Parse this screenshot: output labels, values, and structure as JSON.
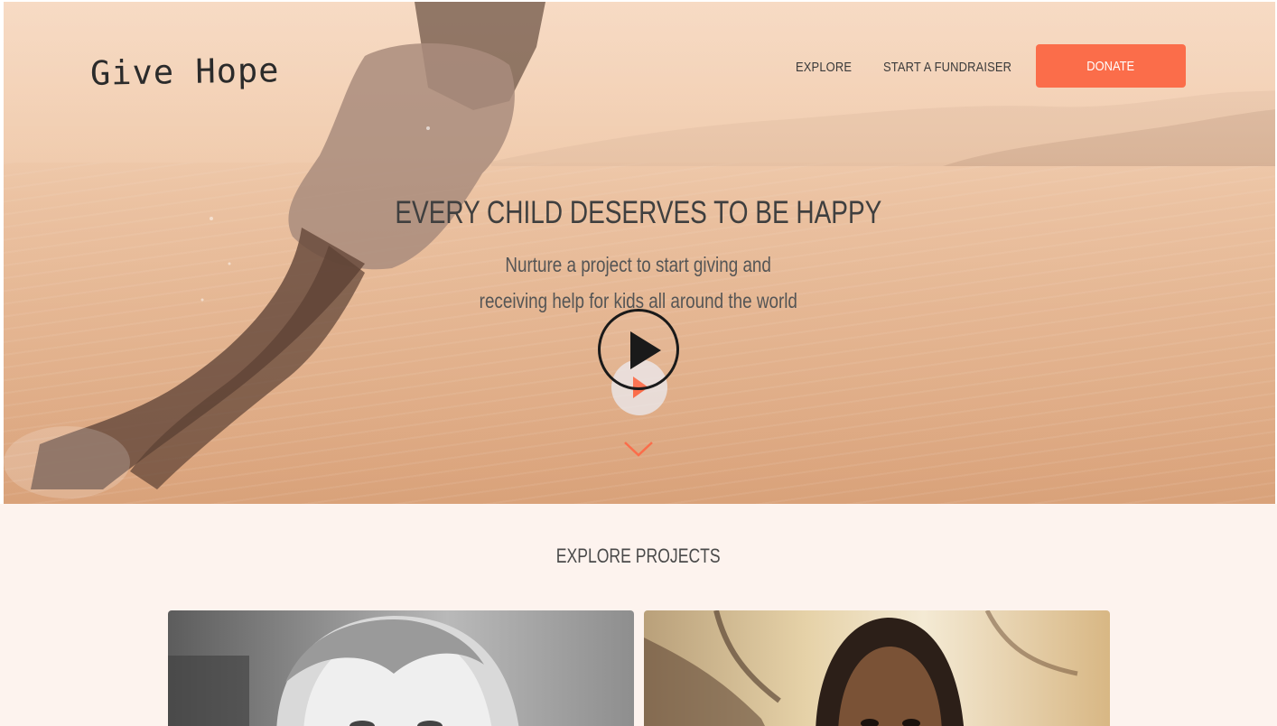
{
  "header": {
    "logo": "Give Hope",
    "nav": {
      "explore_label": "EXPLORE",
      "start_label": "START A FUNDRAISER"
    },
    "donate_label": "DONATE"
  },
  "hero": {
    "headline": "EVERY CHILD DESERVES TO BE HAPPY",
    "subline_1": "Nurture a project to start giving and",
    "subline_2": "receiving help for kids all around the world",
    "play_icon": "play-icon",
    "scroll_icon": "chevron-down-icon"
  },
  "explore": {
    "title": "EXPLORE PROJECTS",
    "cards": [
      {
        "image": "photo-girl-black-and-white"
      },
      {
        "image": "photo-girl-braids"
      }
    ]
  },
  "colors": {
    "accent": "#fb6d4a",
    "section_bg": "#fdf3ee",
    "text_dark": "#3f3f3f"
  }
}
